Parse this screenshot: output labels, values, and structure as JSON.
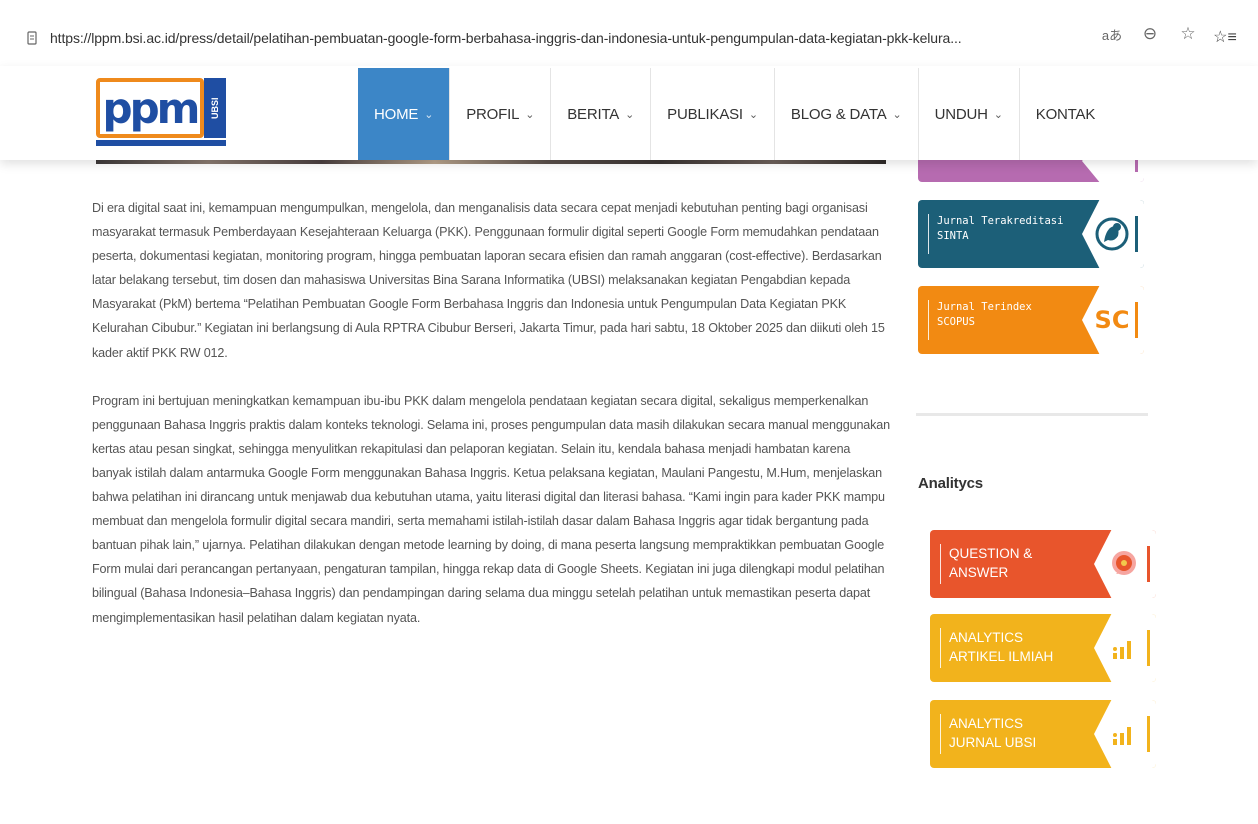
{
  "browser": {
    "url": "https://lppm.bsi.ac.id/press/detail/pelatihan-pembuatan-google-form-berbahasa-inggris-dan-indonesia-untuk-pengumpulan-data-kegiatan-pkk-kelura...",
    "read_aloud_icon": "aあ",
    "zoom_icon": "⊖",
    "favorite_icon": "☆",
    "collections_icon": "☆≡"
  },
  "site": {
    "logo_text": "ppm",
    "logo_side": "UBSI",
    "nav": [
      {
        "label": "HOME",
        "active": true,
        "has_dropdown": true
      },
      {
        "label": "PROFIL",
        "active": false,
        "has_dropdown": true
      },
      {
        "label": "BERITA",
        "active": false,
        "has_dropdown": true
      },
      {
        "label": "PUBLIKASI",
        "active": false,
        "has_dropdown": true
      },
      {
        "label": "BLOG & DATA",
        "active": false,
        "has_dropdown": true
      },
      {
        "label": "UNDUH",
        "active": false,
        "has_dropdown": true
      },
      {
        "label": "KONTAK",
        "active": false,
        "has_dropdown": false
      }
    ],
    "chevron": "⌄"
  },
  "article": {
    "paragraphs": [
      "Di era digital saat ini, kemampuan mengumpulkan, mengelola, dan menganalisis data secara cepat menjadi kebutuhan penting bagi organisasi masyarakat termasuk Pemberdayaan Kesejahteraan Keluarga (PKK). Penggunaan formulir digital seperti Google Form memudahkan pendataan peserta, dokumentasi kegiatan, monitoring program, hingga pembuatan laporan secara efisien dan ramah anggaran (cost-effective). Berdasarkan latar belakang tersebut, tim dosen dan mahasiswa Universitas Bina Sarana Informatika (UBSI) melaksanakan kegiatan Pengabdian kepada Masyarakat (PkM) bertema “Pelatihan Pembuatan Google Form Berbahasa Inggris dan Indonesia untuk Pengumpulan Data Kegiatan PKK Kelurahan Cibubur.” Kegiatan ini berlangsung di Aula RPTRA Cibubur Berseri, Jakarta Timur, pada hari sabtu, 18 Oktober 2025 dan diikuti oleh 15 kader aktif PKK RW 012.",
      "Program ini bertujuan meningkatkan kemampuan ibu-ibu PKK dalam mengelola pendataan kegiatan secara digital, sekaligus memperkenalkan penggunaan Bahasa Inggris praktis dalam konteks teknologi. Selama ini, proses pengumpulan data masih dilakukan secara manual menggunakan kertas atau pesan singkat, sehingga menyulitkan rekapitulasi dan pelaporan kegiatan. Selain itu, kendala bahasa menjadi hambatan karena banyak istilah dalam antarmuka Google Form menggunakan Bahasa Inggris. Ketua pelaksana kegiatan, Maulani Pangestu, M.Hum, menjelaskan bahwa pelatihan ini dirancang untuk menjawab dua kebutuhan utama, yaitu literasi digital dan literasi bahasa. “Kami ingin para kader PKK mampu membuat dan mengelola formulir digital secara mandiri, serta memahami istilah-istilah dasar dalam Bahasa Inggris agar tidak bergantung pada bantuan pihak lain,” ujarnya. Pelatihan dilakukan dengan metode learning by doing, di mana peserta langsung mempraktikkan pembuatan Google Form mulai dari perancangan pertanyaan, pengaturan tampilan, hingga rekap data di Google Sheets. Kegiatan ini juga dilengkapi modul pelatihan bilingual (Bahasa Indonesia–Bahasa Inggris) dan pendampingan daring selama dua minggu setelah pelatihan untuk memastikan peserta dapat mengimplementasikan hasil pelatihan dalam kegiatan nyata."
    ]
  },
  "sidebar": {
    "journals": [
      {
        "label": "Jurnal Terakreditasi SINTA",
        "color": "#1c5f78",
        "badge": "SINTA-icon"
      },
      {
        "label": "Jurnal Terindex SCOPUS",
        "color": "#f28a12",
        "badge_text": "SC"
      }
    ],
    "analytics_title": "Analitycs",
    "analytics": [
      {
        "label": "QUESTION & ANSWER",
        "color": "#e8552c"
      },
      {
        "label": "ANALYTICS ARTIKEL ILMIAH",
        "color": "#f2b31c"
      },
      {
        "label": "ANALYTICS JURNAL UBSI",
        "color": "#f2b31c"
      }
    ]
  }
}
